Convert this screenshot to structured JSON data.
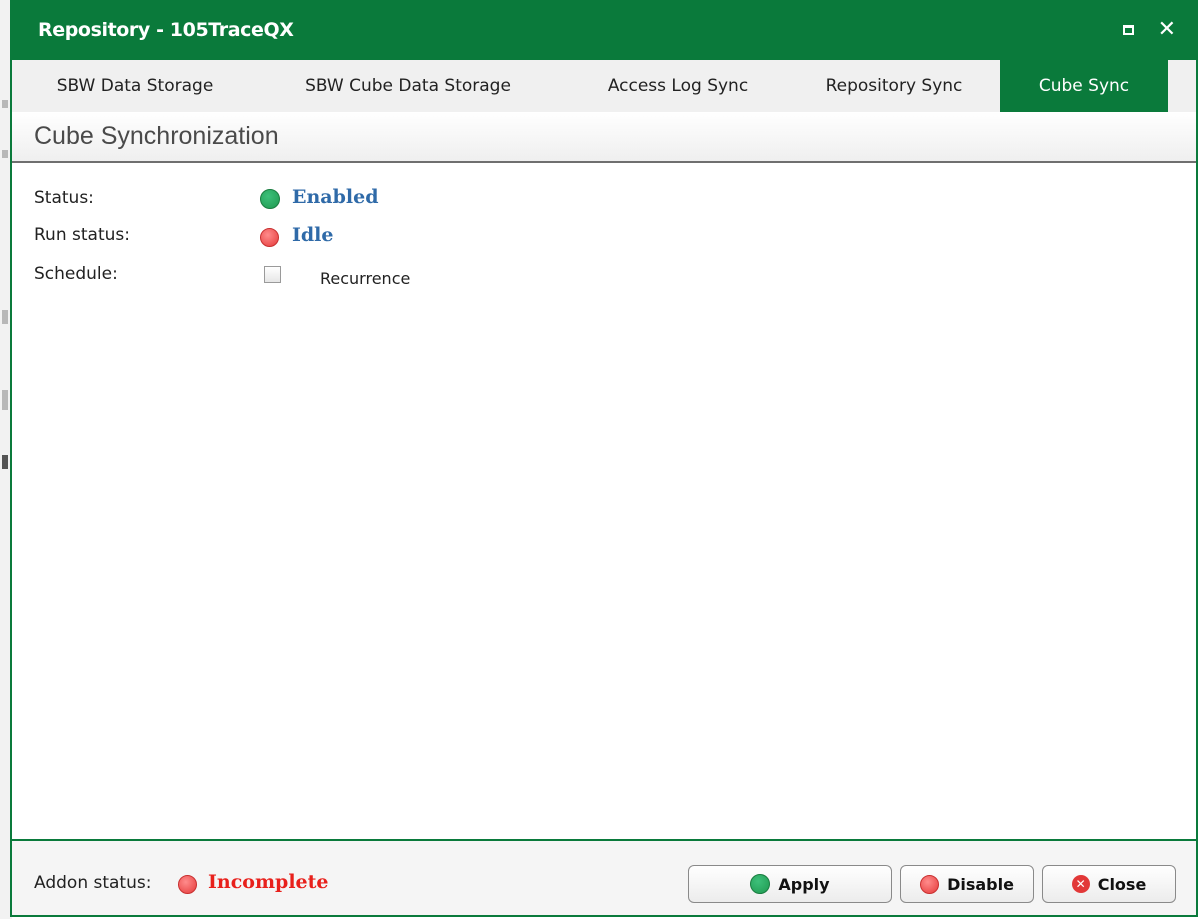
{
  "window": {
    "title": "Repository - 105TraceQX",
    "maximize_symbol": "■",
    "close_symbol": "✕"
  },
  "tabs": [
    {
      "label": "SBW Data Storage",
      "active": false
    },
    {
      "label": "SBW Cube Data Storage",
      "active": false
    },
    {
      "label": "Access Log Sync",
      "active": false
    },
    {
      "label": "Repository Sync",
      "active": false
    },
    {
      "label": "Cube Sync",
      "active": true
    }
  ],
  "section": {
    "title": "Cube Synchronization"
  },
  "fields": {
    "status_label": "Status:",
    "status_value": "Enabled",
    "run_status_label": "Run status:",
    "run_status_value": "Idle",
    "schedule_label": "Schedule:",
    "recurrence_label": "Recurrence",
    "recurrence_checked": false
  },
  "footer": {
    "addon_status_label": "Addon status:",
    "addon_status_value": "Incomplete",
    "apply_label": "Apply",
    "disable_label": "Disable",
    "close_label": "Close"
  },
  "colors": {
    "brand_green": "#0a7a3b",
    "status_blue": "#2f6aa8",
    "error_red": "#e8201b",
    "indicator_green": "#1f9950",
    "indicator_red": "#e53a3a"
  }
}
